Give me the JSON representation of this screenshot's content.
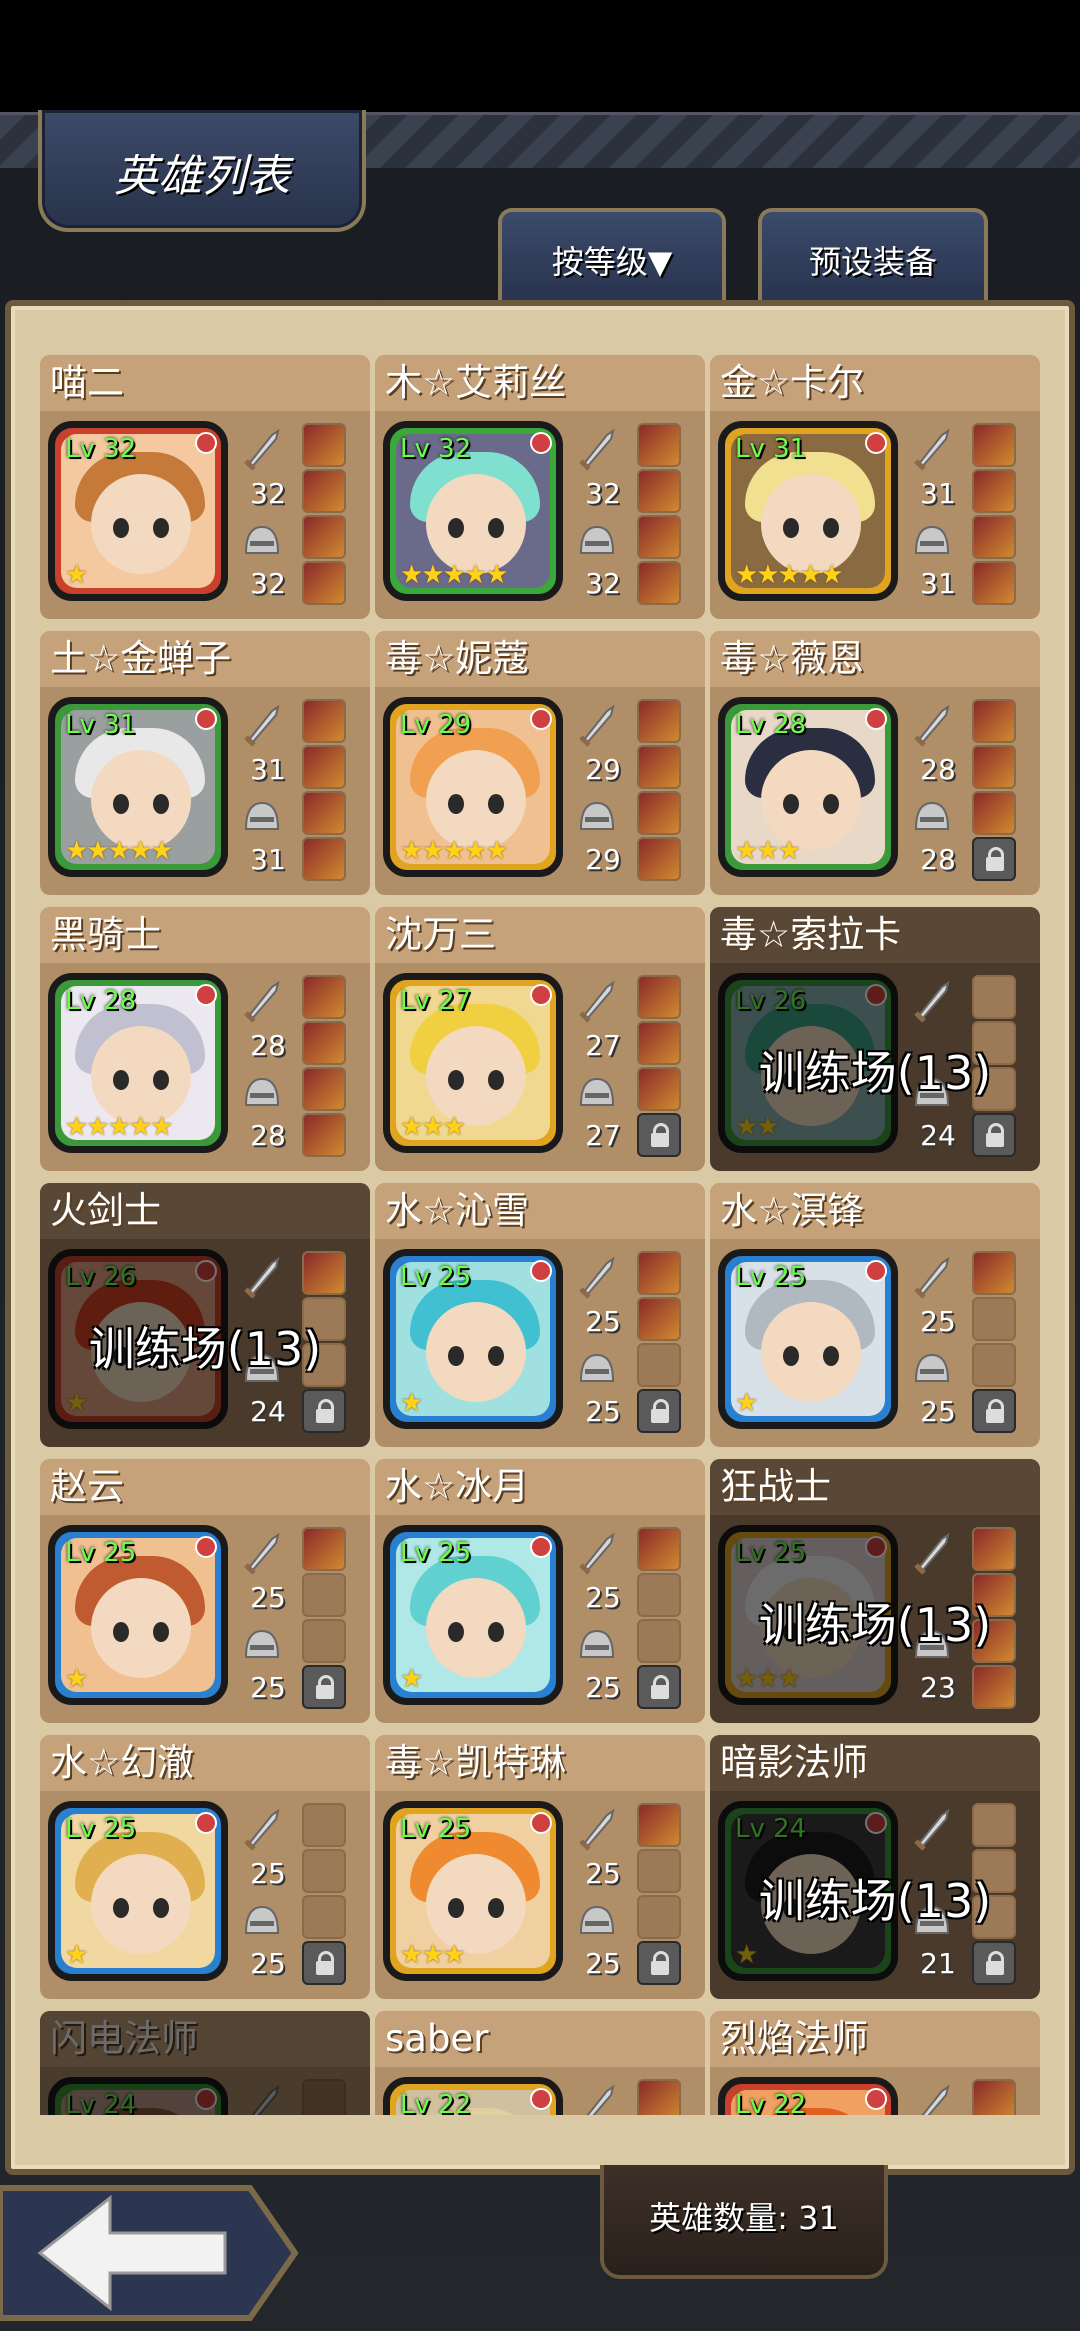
{
  "header": {
    "title": "英雄列表",
    "sort_label": "按等级▼",
    "preset_label": "预设装备"
  },
  "footer": {
    "hero_count_label": "英雄数量: 31"
  },
  "heroes": [
    {
      "name": "喵二",
      "lv": "Lv 32",
      "stars": "★",
      "weapon": "32",
      "armor": "32",
      "frame": "#c9402c",
      "bg": "#f4c9a0",
      "hair": "#c67a3a",
      "slots": [
        "item",
        "item",
        "item",
        "item"
      ],
      "train": ""
    },
    {
      "name": "木☆艾莉丝",
      "lv": "Lv 32",
      "stars": "★★★★★",
      "weapon": "32",
      "armor": "32",
      "frame": "#3aa83a",
      "bg": "#6a6a8a",
      "hair": "#7fe0d0",
      "slots": [
        "item",
        "item",
        "item",
        "item"
      ],
      "train": ""
    },
    {
      "name": "金☆卡尔",
      "lv": "Lv 31",
      "stars": "★★★★★",
      "weapon": "31",
      "armor": "31",
      "frame": "#e0a420",
      "bg": "#8a6a40",
      "hair": "#f0e090",
      "slots": [
        "item",
        "item",
        "item",
        "item"
      ],
      "train": ""
    },
    {
      "name": "土☆金蝉子",
      "lv": "Lv 31",
      "stars": "★★★★★",
      "weapon": "31",
      "armor": "31",
      "frame": "#3a9a3a",
      "bg": "#9aa0a0",
      "hair": "#e8e8e8",
      "slots": [
        "item",
        "item",
        "item",
        "item"
      ],
      "train": ""
    },
    {
      "name": "毒☆妮蔻",
      "lv": "Lv 29",
      "stars": "★★★★★",
      "weapon": "29",
      "armor": "29",
      "frame": "#e0a420",
      "bg": "#f0c090",
      "hair": "#f0a050",
      "slots": [
        "item",
        "item",
        "item",
        "item"
      ],
      "train": ""
    },
    {
      "name": "毒☆薇恩",
      "lv": "Lv 28",
      "stars": "★★★",
      "weapon": "28",
      "armor": "28",
      "frame": "#3a9a3a",
      "bg": "#e8d8c8",
      "hair": "#2a2e40",
      "slots": [
        "item",
        "item",
        "item",
        "lock"
      ],
      "train": ""
    },
    {
      "name": "黑骑士",
      "lv": "Lv 28",
      "stars": "★★★★★",
      "weapon": "28",
      "armor": "28",
      "frame": "#3a9a3a",
      "bg": "#ece8f0",
      "hair": "#c0c0d0",
      "slots": [
        "item",
        "item",
        "item",
        "item"
      ],
      "train": ""
    },
    {
      "name": "沈万三",
      "lv": "Lv 27",
      "stars": "★★★",
      "weapon": "27",
      "armor": "27",
      "frame": "#e0a420",
      "bg": "#f0d890",
      "hair": "#f0d040",
      "slots": [
        "item",
        "item",
        "item",
        "lock"
      ],
      "train": ""
    },
    {
      "name": "毒☆索拉卡",
      "lv": "Lv 26",
      "stars": "★★",
      "weapon": "",
      "armor": "24",
      "frame": "#3a9a3a",
      "bg": "#8ab0b0",
      "hair": "#3aa080",
      "slots": [
        "empty",
        "empty",
        "empty",
        "lock"
      ],
      "train": "训练场(13)"
    },
    {
      "name": "火剑士",
      "lv": "Lv 26",
      "stars": "★",
      "weapon": "",
      "armor": "24",
      "frame": "#c9402c",
      "bg": "#e0a080",
      "hair": "#d04020",
      "slots": [
        "item",
        "empty",
        "empty",
        "lock"
      ],
      "train": "训练场(13)"
    },
    {
      "name": "水☆沁雪",
      "lv": "Lv 25",
      "stars": "★",
      "weapon": "25",
      "armor": "25",
      "frame": "#2a80d0",
      "bg": "#a0e0e0",
      "hair": "#40c0d0",
      "slots": [
        "item",
        "item",
        "empty",
        "lock"
      ],
      "train": ""
    },
    {
      "name": "水☆溟锋",
      "lv": "Lv 25",
      "stars": "★",
      "weapon": "25",
      "armor": "25",
      "frame": "#2a80d0",
      "bg": "#d8e0e8",
      "hair": "#b0b8c0",
      "slots": [
        "item",
        "empty",
        "empty",
        "lock"
      ],
      "train": ""
    },
    {
      "name": "赵云",
      "lv": "Lv 25",
      "stars": "★",
      "weapon": "25",
      "armor": "25",
      "frame": "#2a80d0",
      "bg": "#f0c090",
      "hair": "#c05a30",
      "slots": [
        "item",
        "empty",
        "empty",
        "lock"
      ],
      "train": ""
    },
    {
      "name": "水☆冰月",
      "lv": "Lv 25",
      "stars": "★",
      "weapon": "25",
      "armor": "25",
      "frame": "#2a80d0",
      "bg": "#b0e8e8",
      "hair": "#60d0d0",
      "slots": [
        "item",
        "empty",
        "empty",
        "lock"
      ],
      "train": ""
    },
    {
      "name": "狂战士",
      "lv": "Lv 25",
      "stars": "★★★",
      "weapon": "",
      "armor": "23",
      "frame": "#e0a420",
      "bg": "#e0d0d0",
      "hair": "#f0f0f0",
      "slots": [
        "item",
        "item",
        "item",
        "item"
      ],
      "train": "训练场(13)"
    },
    {
      "name": "水☆幻澈",
      "lv": "Lv 25",
      "stars": "★",
      "weapon": "25",
      "armor": "25",
      "frame": "#2a80d0",
      "bg": "#f0d8a0",
      "hair": "#e0b050",
      "slots": [
        "empty",
        "empty",
        "empty",
        "lock"
      ],
      "train": ""
    },
    {
      "name": "毒☆凯特琳",
      "lv": "Lv 25",
      "stars": "★★★",
      "weapon": "25",
      "armor": "25",
      "frame": "#e0a420",
      "bg": "#f0d0a0",
      "hair": "#f08a30",
      "slots": [
        "item",
        "empty",
        "empty",
        "lock"
      ],
      "train": ""
    },
    {
      "name": "暗影法师",
      "lv": "Lv 24",
      "stars": "★",
      "weapon": "",
      "armor": "21",
      "frame": "#3a9a3a",
      "bg": "#3a3a3a",
      "hair": "#1a1a1a",
      "slots": [
        "empty",
        "empty",
        "empty",
        "lock"
      ],
      "train": "训练场(13)"
    },
    {
      "name": "闪电法师",
      "lv": "Lv 24",
      "stars": "",
      "weapon": "",
      "armor": "",
      "frame": "#3a9a3a",
      "bg": "#c0a090",
      "hair": "#8a5a3a",
      "slots": [
        "empty",
        "empty",
        "empty",
        "empty"
      ],
      "train": "",
      "dim": true
    },
    {
      "name": "saber",
      "lv": "Lv 22",
      "stars": "",
      "weapon": "",
      "armor": "",
      "frame": "#e0a420",
      "bg": "#d0c0a0",
      "hair": "#e0d0a0",
      "slots": [
        "item",
        "empty",
        "empty",
        "empty"
      ],
      "train": ""
    },
    {
      "name": "烈焰法师",
      "lv": "Lv 22",
      "stars": "",
      "weapon": "",
      "armor": "",
      "frame": "#c9402c",
      "bg": "#f0a060",
      "hair": "#e06020",
      "slots": [
        "item",
        "empty",
        "empty",
        "empty"
      ],
      "train": ""
    }
  ]
}
